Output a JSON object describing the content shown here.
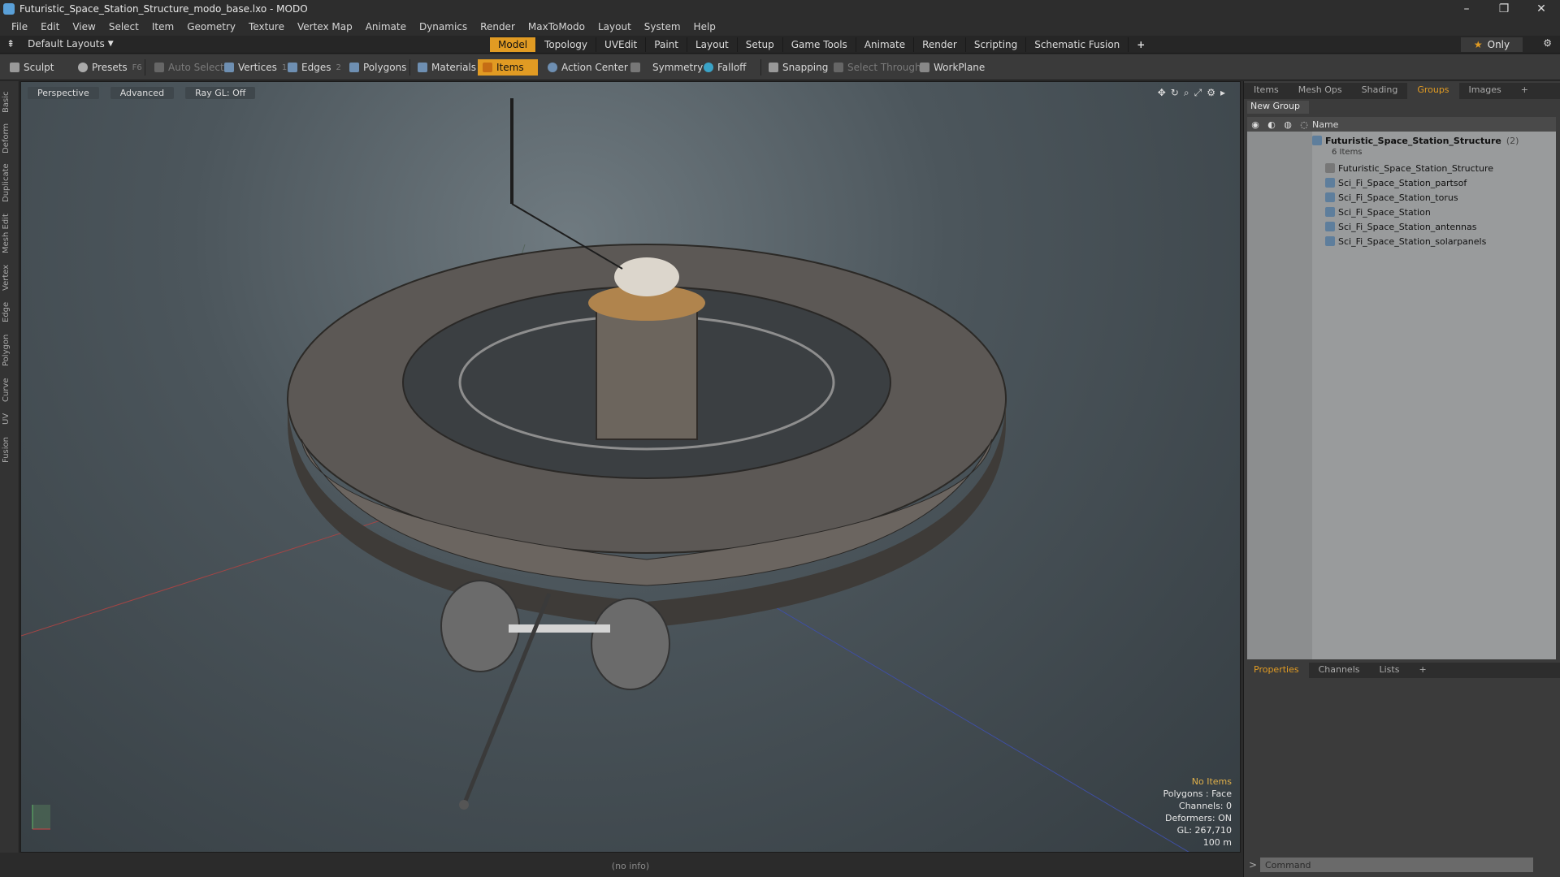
{
  "window": {
    "title": "Futuristic_Space_Station_Structure_modo_base.lxo - MODO",
    "controls": [
      "–",
      "❐",
      "✕"
    ]
  },
  "menu": [
    "File",
    "Edit",
    "View",
    "Select",
    "Item",
    "Geometry",
    "Texture",
    "Vertex Map",
    "Animate",
    "Dynamics",
    "Render",
    "MaxToModo",
    "Layout",
    "System",
    "Help"
  ],
  "layout": {
    "selector": "Default Layouts",
    "tabs": [
      "Model",
      "Topology",
      "UVEdit",
      "Paint",
      "Layout",
      "Setup",
      "Game Tools",
      "Animate",
      "Render",
      "Scripting",
      "Schematic Fusion"
    ],
    "active_tab": "Model",
    "only_label": "Only"
  },
  "toolbar": {
    "sculpt": "Sculpt",
    "presets": "Presets",
    "presets_key": "F6",
    "auto_select": "Auto Select",
    "vertices": "Vertices",
    "vertices_key": "1",
    "edges": "Edges",
    "edges_key": "2",
    "polygons": "Polygons",
    "materials": "Materials",
    "items": "Items",
    "action_center": "Action Center",
    "symmetry": "Symmetry",
    "falloff": "Falloff",
    "snapping": "Snapping",
    "select_through": "Select Through",
    "workplane": "WorkPlane"
  },
  "left_strip": [
    "Basic",
    "Deform",
    "Duplicate",
    "Mesh Edit",
    "Vertex",
    "Edge",
    "Polygon",
    "Curve",
    "UV",
    "Fusion"
  ],
  "viewport": {
    "view_mode": "Perspective",
    "advanced": "Advanced",
    "raygl": "Ray GL: Off",
    "info": {
      "no_items": "No Items",
      "polygons": "Polygons : Face",
      "channels": "Channels: 0",
      "deformers": "Deformers: ON",
      "gl": "GL: 267,710",
      "scale": "100 m"
    }
  },
  "status": {
    "info": "(no info)"
  },
  "panel": {
    "tabs": [
      "Items",
      "Mesh Ops",
      "Shading",
      "Groups",
      "Images"
    ],
    "active_tab": "Groups",
    "new_group": "New Group",
    "name_header": "Name",
    "group_name": "Futuristic_Space_Station_Structure",
    "group_count": "(2)",
    "group_sub": "6 Items",
    "items": [
      "Futuristic_Space_Station_Structure",
      "Sci_Fi_Space_Station_partsof",
      "Sci_Fi_Space_Station_torus",
      "Sci_Fi_Space_Station",
      "Sci_Fi_Space_Station_antennas",
      "Sci_Fi_Space_Station_solarpanels"
    ],
    "bottom_tabs": [
      "Properties",
      "Channels",
      "Lists"
    ],
    "bottom_active": "Properties",
    "command_placeholder": "Command"
  },
  "colors": {
    "accent": "#e19b23",
    "ui_dark": "#2d2d2d"
  }
}
